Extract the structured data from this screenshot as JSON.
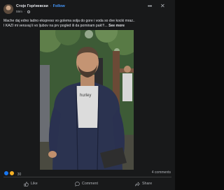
{
  "post": {
    "author": "Стоjе Горѓиевски",
    "separator": "·",
    "follow_label": "Follow",
    "timestamp": "59m",
    "privacy_icon": "globe-icon",
    "caption_lines": [
      "Mache daj edno ladno ekspreso vo golema solja do gore i voda so dve kocki mraz..",
      "I KAZI mi veruvaj li vo ljubov na prv pogled ili da pominam pak!!!... "
    ],
    "see_more_label": "See more",
    "image": {
      "icon": "photo",
      "shirt_text": "hurley"
    },
    "reactions_count": "30",
    "comments_count": "4 comments",
    "actions": {
      "like_label": "Like",
      "comment_label": "Comment",
      "share_label": "Share"
    }
  },
  "colors": {
    "background": "#18191a",
    "text": "#e4e6eb",
    "secondary_text": "#b0b3b8",
    "follow_link": "#4599ff",
    "like_reaction": "#1877f2",
    "haha_reaction": "#f7b125"
  }
}
